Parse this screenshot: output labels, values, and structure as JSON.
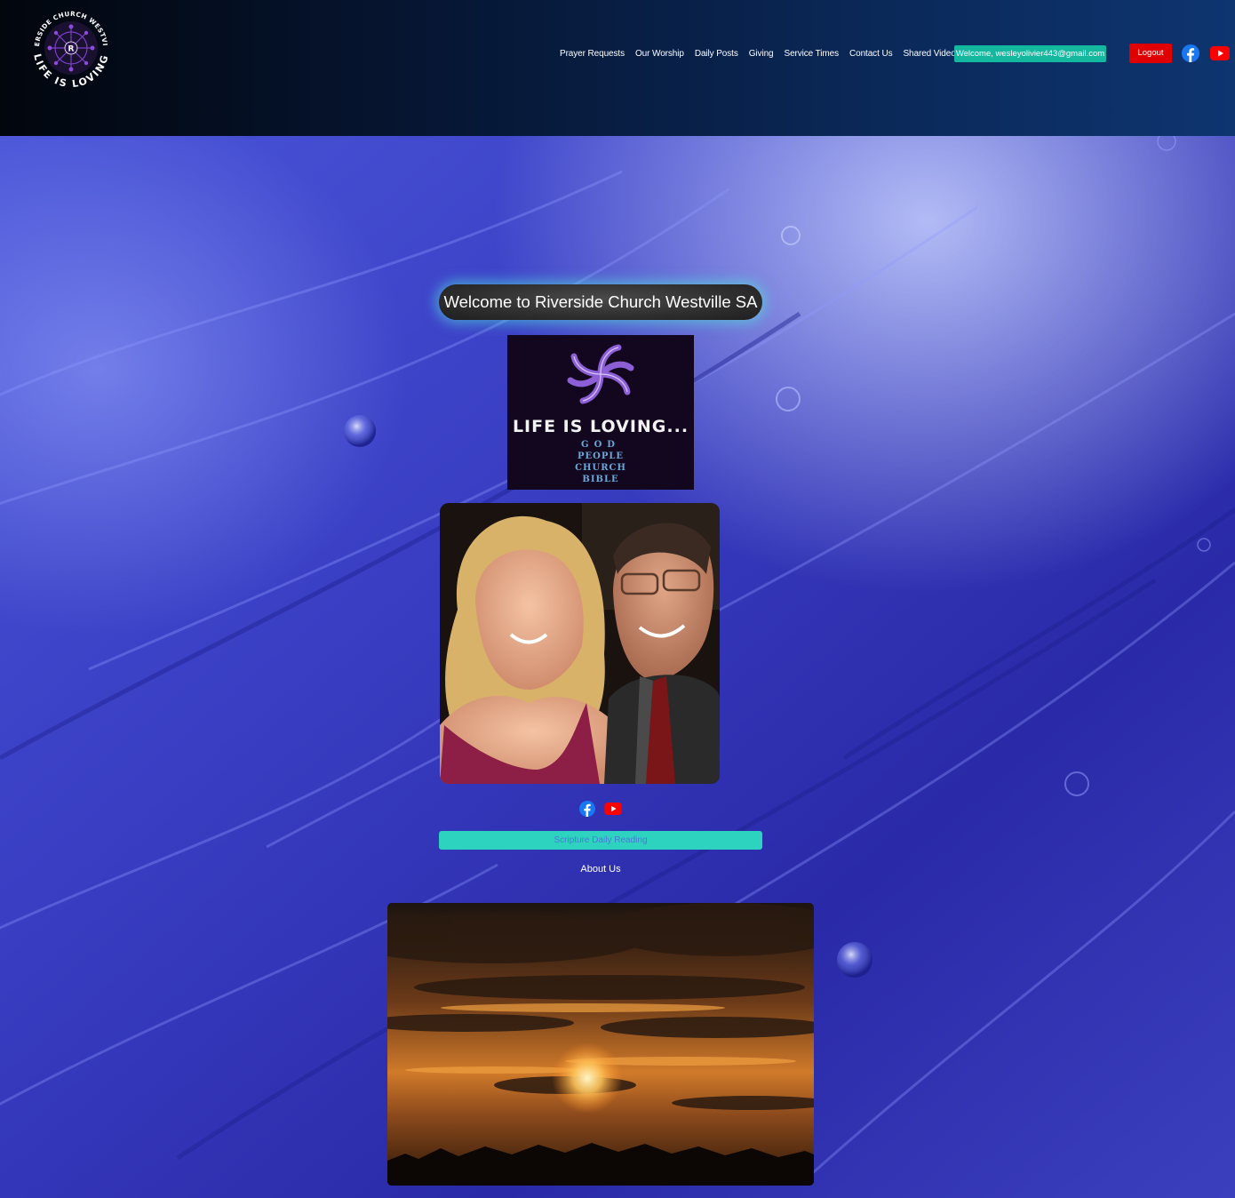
{
  "header": {
    "logo": {
      "ring_text_top": "RIVERSIDE CHURCH WESTVILLE",
      "ring_text_bottom": "LIFE IS LOVING",
      "center_letter": "R"
    },
    "nav": [
      {
        "label": "Prayer Requests"
      },
      {
        "label": "Our Worship"
      },
      {
        "label": "Daily Posts"
      },
      {
        "label": "Giving"
      },
      {
        "label": "Service Times"
      },
      {
        "label": "Contact Us"
      },
      {
        "label": "Shared Videos"
      }
    ],
    "welcome_user": "Welcome, wesleyolivier443@gmail.com",
    "logout_label": "Logout",
    "icons": {
      "facebook": "facebook-icon",
      "youtube": "youtube-icon"
    },
    "colors": {
      "welcome_bg": "#14b89e",
      "logout_bg": "#e00000",
      "facebook": "#1877f2",
      "youtube": "#ff0000"
    }
  },
  "main": {
    "title": "Welcome to Riverside Church Westville SA",
    "banner": {
      "headline": "LIFE IS LOVING...",
      "lines": [
        "GOD",
        "PEOPLE",
        "CHURCH",
        "BIBLE"
      ]
    },
    "scripture_button": "Scripture Daily Reading",
    "about_label": "About Us",
    "colors": {
      "scripture_bg": "#2ed3c0",
      "scripture_text": "#4a7ad8"
    }
  }
}
